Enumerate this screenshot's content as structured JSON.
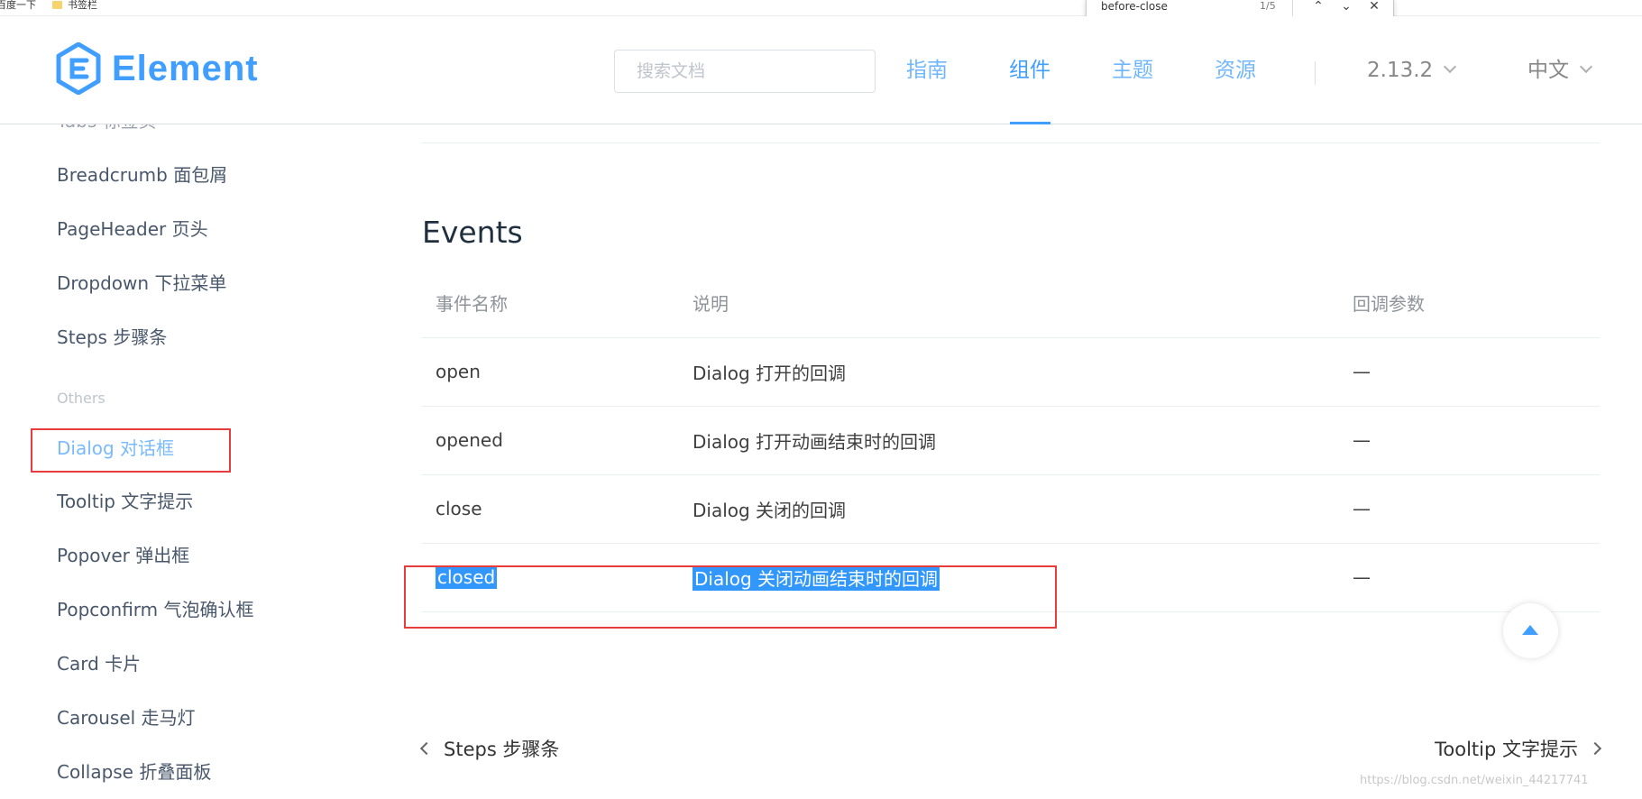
{
  "bookmarks": [
    "百度一下",
    "书签栏"
  ],
  "findbar": {
    "query": "before-close",
    "count": "1/5",
    "prev_icon": "chevron-up-icon",
    "next_icon": "chevron-down-icon",
    "close_icon": "close-icon"
  },
  "header": {
    "logo_text": "Element",
    "search_placeholder": "搜索文档",
    "nav": [
      "指南",
      "组件",
      "主题",
      "资源"
    ],
    "active_nav": "组件",
    "version": "2.13.2",
    "language": "中文"
  },
  "sidebar": {
    "cut_item": "Tabs 标签页",
    "items_before": [
      "Breadcrumb 面包屑",
      "PageHeader 页头",
      "Dropdown 下拉菜单",
      "Steps 步骤条"
    ],
    "group": "Others",
    "active_item": "Dialog 对话框",
    "items_after": [
      "Tooltip 文字提示",
      "Popover 弹出框",
      "Popconfirm 气泡确认框",
      "Card 卡片",
      "Carousel 走马灯",
      "Collapse 折叠面板"
    ]
  },
  "content": {
    "section_title": "Events",
    "headers": [
      "事件名称",
      "说明",
      "回调参数"
    ],
    "rows": [
      [
        "open",
        "Dialog 打开的回调",
        "—"
      ],
      [
        "opened",
        "Dialog 打开动画结束时的回调",
        "—"
      ],
      [
        "close",
        "Dialog 关闭的回调",
        "—"
      ],
      [
        "closed",
        "Dialog 关闭动画结束时的回调",
        "—"
      ]
    ],
    "prev_page": "Steps 步骤条",
    "next_page": "Tooltip 文字提示"
  },
  "colors": {
    "brand": "#409eff",
    "annotation": "#e83c3c",
    "selection": "#3297fd"
  },
  "watermark": "https://blog.csdn.net/weixin_44217741"
}
